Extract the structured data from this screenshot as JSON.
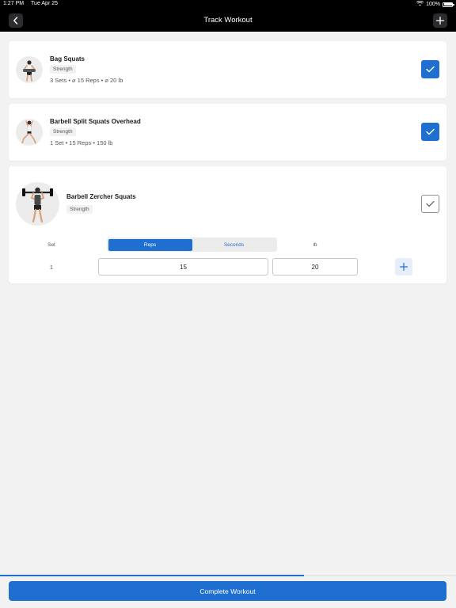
{
  "status_bar": {
    "time": "1:27 PM",
    "date": "Tue Apr 25",
    "battery": "100%",
    "battery_level": 1.0
  },
  "nav": {
    "title": "Track Workout",
    "back_icon": "chevron-left-icon",
    "add_icon": "plus-icon"
  },
  "exercises": [
    {
      "name": "Bag Squats",
      "category": "Strength",
      "summary": "3 Sets • ⌀ 15 Reps • ⌀ 20 lb",
      "completed": true
    },
    {
      "name": "Barbell Split Squats Overhead",
      "category": "Strength",
      "summary": "1 Set • 15 Reps • 150 lb",
      "completed": true
    },
    {
      "name": "Barbell Zercher Squats",
      "category": "Strength",
      "completed": false
    }
  ],
  "set_editor": {
    "set_label": "Set",
    "unit_label": "lb",
    "toggle_options": [
      "Reps",
      "Seconds"
    ],
    "selected_toggle": "Reps",
    "sets": [
      {
        "set": "1",
        "reps": "15",
        "weight": "20"
      }
    ]
  },
  "footer": {
    "progress": 0.667,
    "complete_label": "Complete Workout"
  },
  "colors": {
    "accent": "#1f6fd1",
    "nav_background": "#000000",
    "page_background": "#f2f2f3"
  }
}
